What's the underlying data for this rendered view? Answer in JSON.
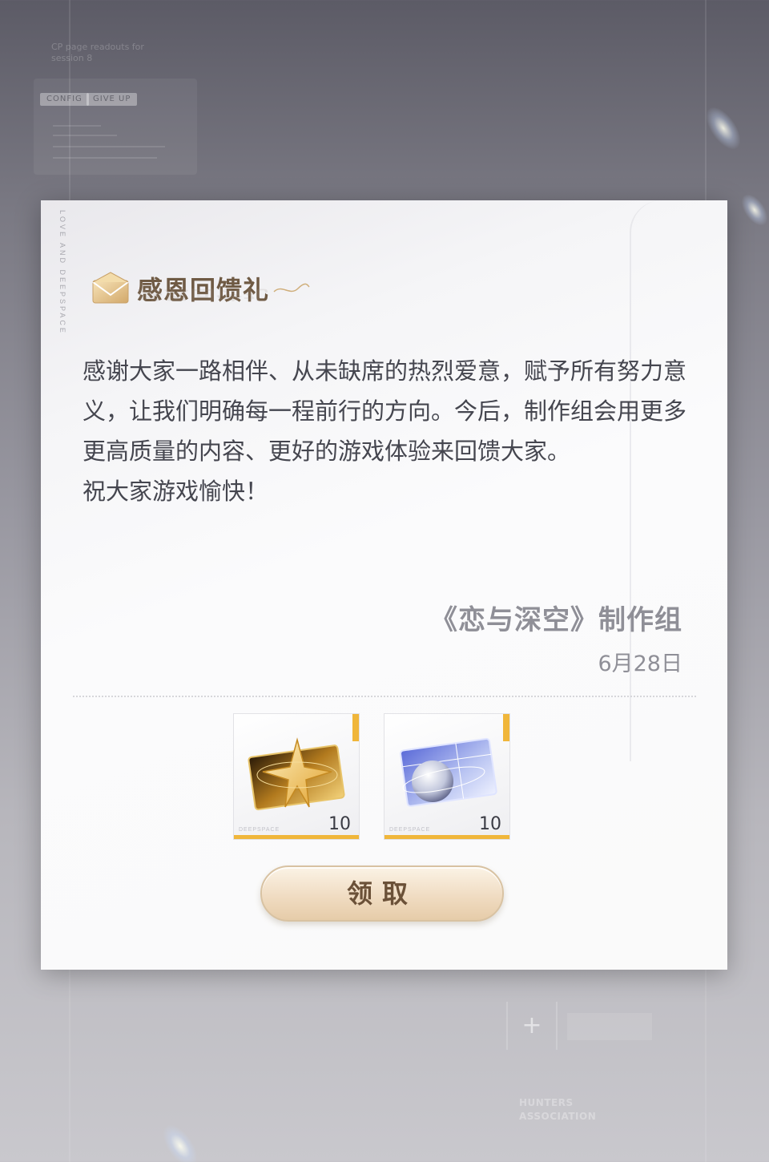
{
  "background": {
    "caption": "CP page readouts for\nsession 8",
    "tags": [
      "CONFIG",
      "GIVE UP"
    ],
    "plus_label": "+",
    "association_lines": [
      "HUNTERS",
      "ASSOCIATION"
    ]
  },
  "dialog": {
    "side_text": "LOVE AND DEEPSPACE",
    "title": "感恩回馈礼",
    "body": [
      "感谢大家一路相伴、从未缺席的热烈爱意，赋予所有努力意义，让我们明确每一程前行的方向。今后，制作组会用更多更高质量的内容、更好的游戏体验来回馈大家。",
      "祝大家游戏愉快！"
    ],
    "signature": "《恋与深空》制作组",
    "date": "6月28日",
    "rewards": [
      {
        "icon": "golden-star-card-icon",
        "count": "10",
        "watermark": "DEEPSPACE"
      },
      {
        "icon": "moon-card-icon",
        "count": "10",
        "watermark": "DEEPSPACE"
      }
    ],
    "claim_button": "领取"
  },
  "colors": {
    "title": "#6f5a44",
    "body_text": "#45464f",
    "signature": "#8f8f97",
    "reward_accent": "#f0b63a",
    "button_text": "#6b5138"
  }
}
